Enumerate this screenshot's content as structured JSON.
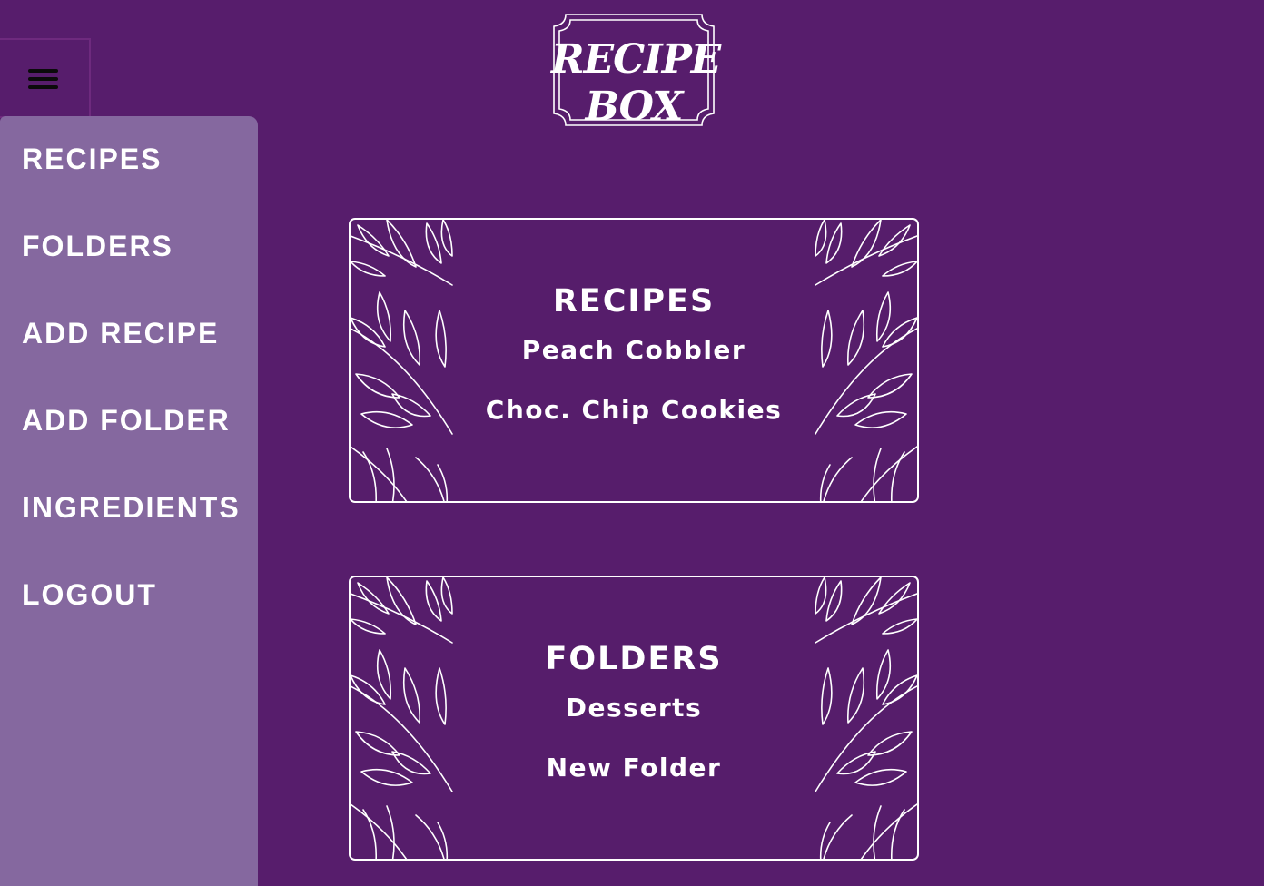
{
  "logo": {
    "line1": "RECIPE",
    "line2": "BOX"
  },
  "menu_toggle": {
    "icon": "hamburger-icon"
  },
  "sidebar": {
    "items": [
      {
        "label": "RECIPES"
      },
      {
        "label": "FOLDERS"
      },
      {
        "label": "ADD RECIPE"
      },
      {
        "label": "ADD FOLDER"
      },
      {
        "label": "INGREDIENTS"
      },
      {
        "label": "LOGOUT"
      }
    ]
  },
  "cards": {
    "recipes": {
      "title": "RECIPES",
      "items": [
        "Peach Cobbler",
        "Choc. Chip Cookies"
      ]
    },
    "folders": {
      "title": "FOLDERS",
      "items": [
        "Desserts",
        "New Folder"
      ]
    }
  },
  "colors": {
    "background": "#571d6c",
    "sidebar": "#85689f",
    "text": "#ffffff",
    "card_border": "#ffffff"
  }
}
